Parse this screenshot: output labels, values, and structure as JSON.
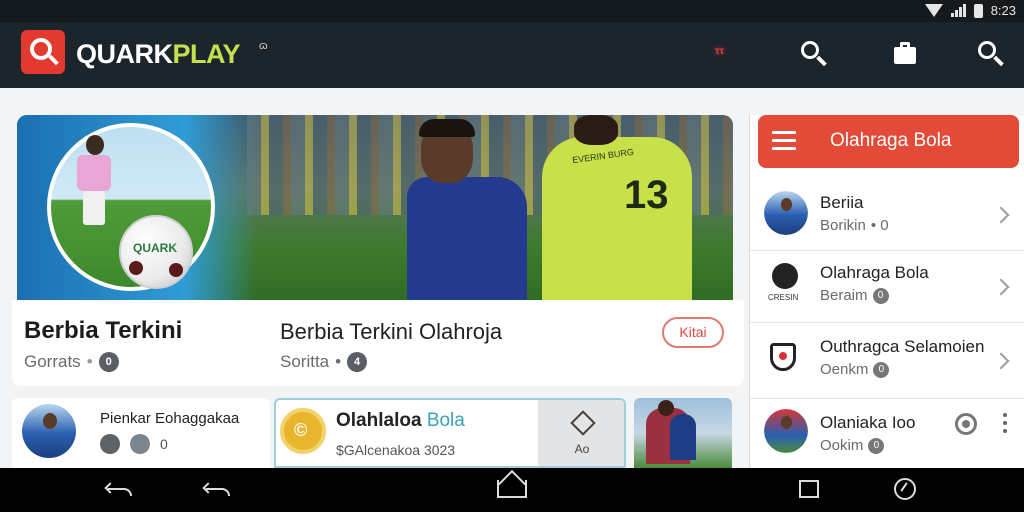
{
  "status_bar": {
    "time": "8:23"
  },
  "app_bar": {
    "brand_part1": "QUARK",
    "brand_part2": "PLAY",
    "brand_suffix": "ɷ",
    "indicator": "ττ",
    "icons": [
      "search-icon",
      "briefcase-icon",
      "search-icon"
    ]
  },
  "hero": {
    "ball_text": "QUARK",
    "jersey_number": "13",
    "jersey_text": "EVERIN BURG",
    "title": "Berbia Terkini",
    "meta": "Gorrats",
    "meta_badge": "0",
    "title2": "Berbia Terkini Olahroja",
    "meta2": "Soritta",
    "meta2_badge": "4",
    "tag": "Kitai"
  },
  "cards": [
    {
      "title": "Pienkar Eohaggakaa",
      "num": "0"
    },
    {
      "title_bold": "Olahlaloa",
      "title_hl": "Bola",
      "subtitle": "$GAlcenakoa 3023",
      "side_label": "Ao"
    }
  ],
  "sidebar": {
    "header": "Olahraga Bola",
    "items": [
      {
        "title": "Beriia",
        "sub": "Borikin",
        "sub_extra": "• 0"
      },
      {
        "title": "Olahraga Bola",
        "sub": "Beraim",
        "badge": "0",
        "crest_text": "CRESIN"
      },
      {
        "title": "Outhragca Selamoien",
        "sub": "Oenkm",
        "badge": "0"
      },
      {
        "title": "Olaniaka Ioo",
        "sub": "Ookim",
        "badge": "0"
      }
    ]
  },
  "colors": {
    "accent": "#e34b38",
    "brand_highlight": "#c5e04a",
    "appbar": "#1c242c"
  }
}
